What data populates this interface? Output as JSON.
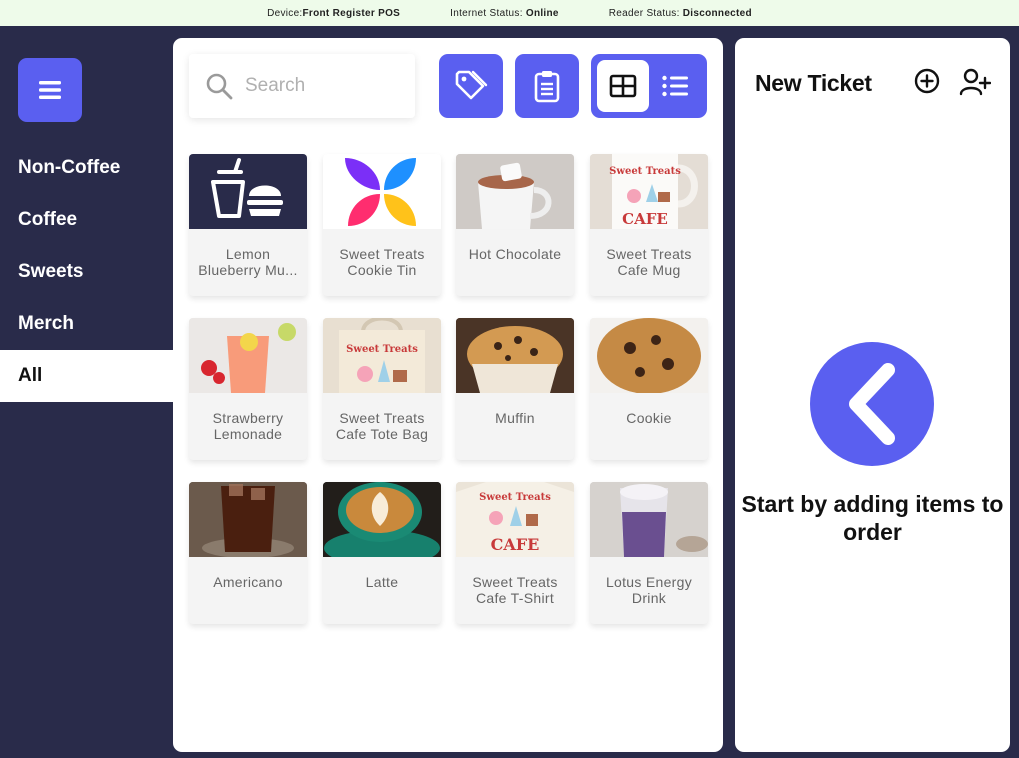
{
  "status_bar": {
    "device_label": "Device:",
    "device_value": "Front Register POS",
    "internet_label": "Internet Status: ",
    "internet_value": "Online",
    "reader_label": "Reader Status: ",
    "reader_value": "Disconnected"
  },
  "sidebar": {
    "menu_icon": "hamburger-icon",
    "items": [
      {
        "label": "Non-Coffee"
      },
      {
        "label": "Coffee"
      },
      {
        "label": "Sweets"
      },
      {
        "label": "Merch"
      },
      {
        "label": "All",
        "active": true
      }
    ]
  },
  "catalog": {
    "search": {
      "placeholder": "Search",
      "value": ""
    },
    "tools": [
      "tag-icon",
      "clipboard-icon"
    ],
    "view_modes": {
      "selected": "grid",
      "options": [
        "grid",
        "list"
      ]
    },
    "items": [
      {
        "name": "Lemon\nBlueberry Mu..."
      },
      {
        "name": "Sweet Treats\nCookie Tin"
      },
      {
        "name": "Hot Chocolate"
      },
      {
        "name": "Sweet Treats\nCafe Mug"
      },
      {
        "name": "Strawberry\nLemonade"
      },
      {
        "name": "Sweet Treats\nCafe Tote Bag"
      },
      {
        "name": "Muffin"
      },
      {
        "name": "Cookie"
      },
      {
        "name": "Americano"
      },
      {
        "name": "Latte"
      },
      {
        "name": "Sweet Treats\nCafe T-Shirt"
      },
      {
        "name": "Lotus Energy\nDrink"
      }
    ],
    "merch_print": {
      "line1": "Sweet Treats",
      "line2": "CAFE"
    }
  },
  "ticket": {
    "title": "New Ticket",
    "empty_message": "Start by adding items to order"
  },
  "colors": {
    "accent": "#5a5ff0",
    "background": "#292b4a",
    "status_bar": "#eefbea"
  }
}
